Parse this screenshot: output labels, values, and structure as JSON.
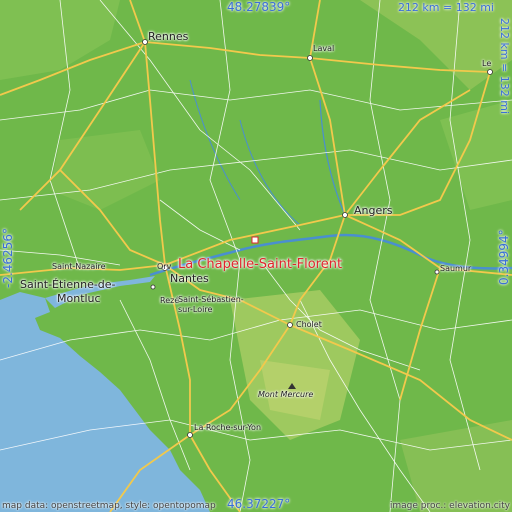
{
  "coordinates": {
    "top": "48.27839°",
    "bottom": "46.37227°",
    "left": "-2.46256°",
    "right": "0.34994°"
  },
  "scale": {
    "horizontal": "212 km = 132 mi",
    "vertical": "212 km = 132 mi"
  },
  "marker": {
    "label": "La Chapelle-Saint-Florent",
    "color": "#e0242c"
  },
  "cities": [
    {
      "name": "Rennes",
      "size": "city"
    },
    {
      "name": "Laval",
      "size": "town"
    },
    {
      "name": "Le",
      "size": "town"
    },
    {
      "name": "Angers",
      "size": "city"
    },
    {
      "name": "Saumur",
      "size": "town"
    },
    {
      "name": "Nantes",
      "size": "city"
    },
    {
      "name": "Orvault",
      "size": "town"
    },
    {
      "name": "Saint-Nazaire",
      "size": "town"
    },
    {
      "name": "Saint-Étienne-de-Montluc",
      "size": "town"
    },
    {
      "name": "Rezé",
      "size": "town"
    },
    {
      "name": "Saint-Sébastien-sur-Loire",
      "size": "town"
    },
    {
      "name": "Cholet",
      "size": "town"
    },
    {
      "name": "Mont Mercure",
      "size": "peak"
    },
    {
      "name": "La Roche-sur-Yon",
      "size": "town"
    }
  ],
  "labels": {
    "rennes": "Rennes",
    "laval": "Laval",
    "le": "Le",
    "angers": "Angers",
    "saumur": "Saumur",
    "nantes": "Nantes",
    "orvault": "Orv",
    "saint_nazaire": "Saint-Nazaire",
    "sem_line1": "Saint-Étienne-de-",
    "sem_line2": "Montluc",
    "reze": "Rezé",
    "ssl_line1": "Saint-Sébastien-",
    "ssl_line2": "sur-Loire",
    "cholet": "Cholet",
    "mont_mercure": "Mont Mercure",
    "roche": "La Roche-sur-Yon"
  },
  "credits": {
    "left": "map data: openstreetmap, style: opentopomap",
    "right": "image proc.: elevation.city"
  },
  "colors": {
    "lowland": "#6fb84a",
    "upland": "#9cc95e",
    "sea": "#7fb6dc",
    "road_major": "#f2c94c",
    "road_minor": "#ffffff",
    "river": "#4a8fcf",
    "accent": "#3a6fd8"
  }
}
